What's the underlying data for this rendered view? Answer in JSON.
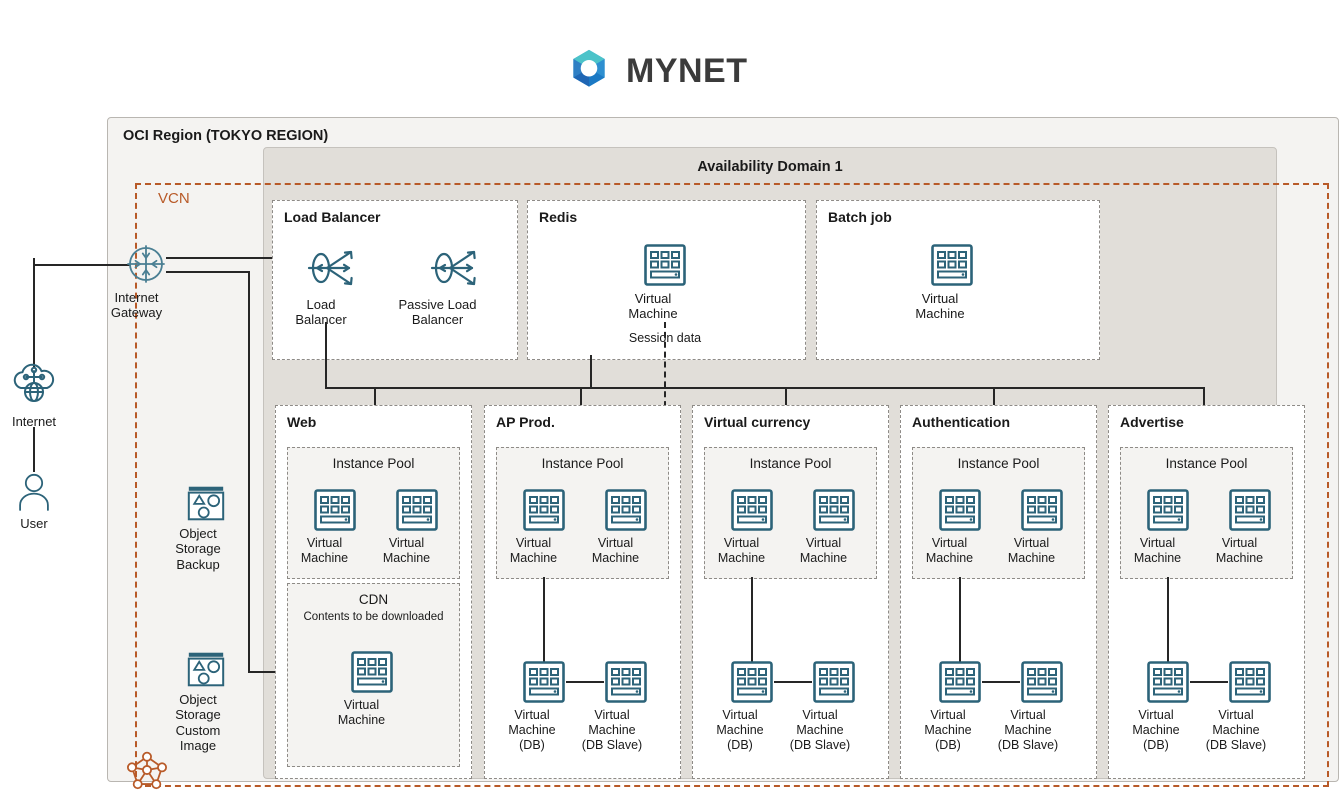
{
  "brand": {
    "name": "MYNET",
    "logo_icon": "mynet-ring-logo",
    "colors": {
      "teal": "#3fb5c4",
      "blue_mid": "#2d9cd8",
      "blue_deep": "#1a5fa8",
      "text": "#3b3b3b"
    }
  },
  "region": {
    "title": "OCI Region (TOKYO REGION)",
    "availability_domain": "Availability Domain 1",
    "vcn_label": "VCN",
    "vcn_color": "#b85a28"
  },
  "external": [
    {
      "label": "Internet",
      "icon": "cloud-globe-icon"
    },
    {
      "label": "User",
      "icon": "user-icon"
    }
  ],
  "gateway": {
    "label": "Internet\nGateway",
    "icon": "internet-gateway-icon"
  },
  "storage": [
    {
      "label": "Object\nStorage\nBackup",
      "icon": "object-storage-icon"
    },
    {
      "label": "Object\nStorage\nCustom\nImage",
      "icon": "object-storage-icon"
    }
  ],
  "vcn_node_icon": "vcn-mesh-icon",
  "top_row": [
    {
      "title": "Load Balancer",
      "nodes": [
        {
          "label": "Load\nBalancer",
          "icon": "load-balancer-icon"
        },
        {
          "label": "Passive Load\nBalancer",
          "icon": "load-balancer-icon"
        }
      ]
    },
    {
      "title": "Redis",
      "nodes": [
        {
          "label": "Virtual\nMachine",
          "icon": "virtual-machine-icon"
        }
      ],
      "footnote": "Session data"
    },
    {
      "title": "Batch job",
      "nodes": [
        {
          "label": "Virtual\nMachine",
          "icon": "virtual-machine-icon"
        }
      ]
    }
  ],
  "columns": [
    {
      "title": "Web",
      "pool": {
        "title": "Instance Pool",
        "nodes": [
          {
            "label": "Virtual\nMachine",
            "icon": "virtual-machine-icon"
          },
          {
            "label": "Virtual\nMachine",
            "icon": "virtual-machine-icon"
          }
        ]
      },
      "cdn": {
        "title": "CDN",
        "subtitle": "Contents to be\ndownloaded",
        "nodes": [
          {
            "label": "Virtual\nMachine",
            "icon": "virtual-machine-icon"
          }
        ]
      }
    },
    {
      "title": "AP Prod.",
      "pool": {
        "title": "Instance Pool",
        "nodes": [
          {
            "label": "Virtual\nMachine",
            "icon": "virtual-machine-icon"
          },
          {
            "label": "Virtual\nMachine",
            "icon": "virtual-machine-icon"
          }
        ]
      },
      "db": [
        {
          "label": "Virtual\nMachine\n(DB)",
          "icon": "virtual-machine-icon"
        },
        {
          "label": "Virtual\nMachine\n(DB Slave)",
          "icon": "virtual-machine-icon"
        }
      ]
    },
    {
      "title": "Virtual currency",
      "pool": {
        "title": "Instance Pool",
        "nodes": [
          {
            "label": "Virtual\nMachine",
            "icon": "virtual-machine-icon"
          },
          {
            "label": "Virtual\nMachine",
            "icon": "virtual-machine-icon"
          }
        ]
      },
      "db": [
        {
          "label": "Virtual\nMachine\n(DB)",
          "icon": "virtual-machine-icon"
        },
        {
          "label": "Virtual\nMachine\n(DB Slave)",
          "icon": "virtual-machine-icon"
        }
      ]
    },
    {
      "title": "Authentication",
      "pool": {
        "title": "Instance Pool",
        "nodes": [
          {
            "label": "Virtual\nMachine",
            "icon": "virtual-machine-icon"
          },
          {
            "label": "Virtual\nMachine",
            "icon": "virtual-machine-icon"
          }
        ]
      },
      "db": [
        {
          "label": "Virtual\nMachine\n(DB)",
          "icon": "virtual-machine-icon"
        },
        {
          "label": "Virtual\nMachine\n(DB Slave)",
          "icon": "virtual-machine-icon"
        }
      ]
    },
    {
      "title": "Advertise",
      "pool": {
        "title": "Instance Pool",
        "nodes": [
          {
            "label": "Virtual\nMachine",
            "icon": "virtual-machine-icon"
          },
          {
            "label": "Virtual\nMachine",
            "icon": "virtual-machine-icon"
          }
        ]
      },
      "db": [
        {
          "label": "Virtual\nMachine\n(DB)",
          "icon": "virtual-machine-icon"
        },
        {
          "label": "Virtual\nMachine\n(DB Slave)",
          "icon": "virtual-machine-icon"
        }
      ]
    }
  ]
}
